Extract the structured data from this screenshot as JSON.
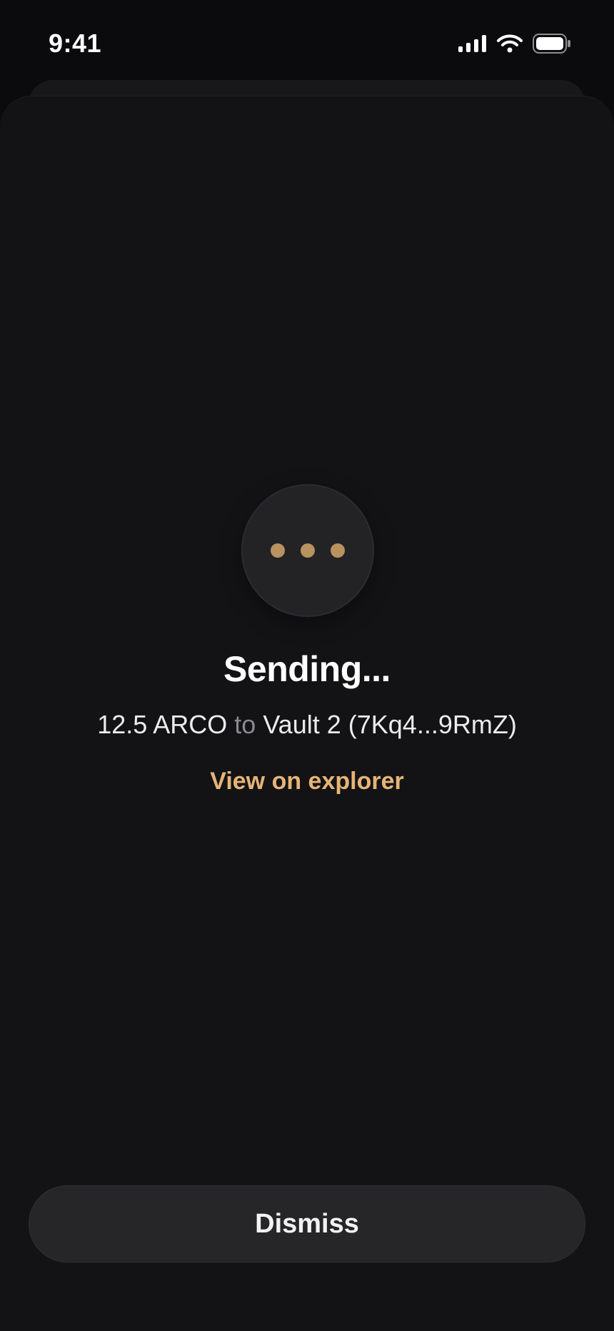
{
  "status_bar": {
    "time": "9:41",
    "icons": [
      "cellular-signal-icon",
      "wifi-icon",
      "battery-icon"
    ]
  },
  "transaction": {
    "title": "Sending...",
    "amount": "12.5 ARCO",
    "connector": "to",
    "recipient": "Vault 2 (7Kq4...9RmZ)",
    "explorer_link": "View on explorer"
  },
  "actions": {
    "dismiss_label": "Dismiss"
  },
  "colors": {
    "accent": "#e6b477",
    "loader_dot": "#b8925f",
    "sheet": "#131315",
    "button": "#262629"
  },
  "icons": {
    "loader": "pending-dots-icon"
  }
}
